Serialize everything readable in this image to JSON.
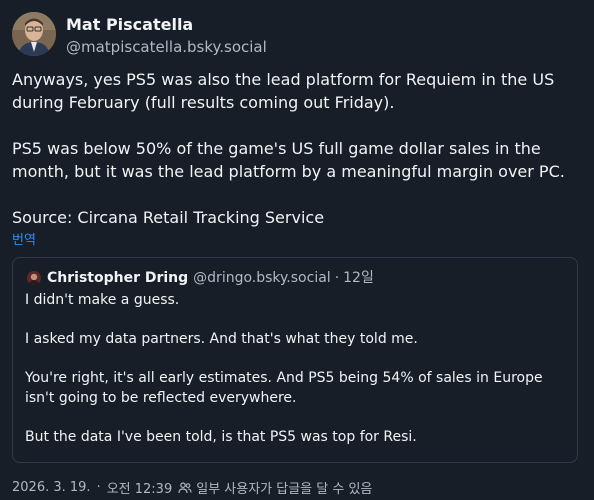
{
  "author": {
    "name": "Mat Piscatella",
    "handle": "@matpiscatella.bsky.social"
  },
  "post": {
    "paragraphs": [
      "Anyways, yes PS5 was also the lead platform for Requiem in the US during February (full results coming out Friday).",
      "PS5 was below 50% of the game's US full game dollar sales in the month, but it was the lead platform by a meaningful margin over PC.",
      "Source: Circana Retail Tracking Service"
    ],
    "translate_label": "번역"
  },
  "quote": {
    "author_name": "Christopher Dring",
    "author_handle": "@dringo.bsky.social",
    "separator": "·",
    "date": "12일",
    "paragraphs": [
      "I didn't make a guess.",
      "I asked my data partners. And that's what they told me.",
      "You're right, it's all early estimates. And PS5 being 54% of sales in Europe isn't going to be reflected everywhere.",
      "But the data I've been told, is that PS5 was top for Resi."
    ]
  },
  "footer": {
    "date": "2026. 3. 19.",
    "separator": "·",
    "time": "오전 12:39",
    "reply_restriction": "일부 사용자가 답글을 달 수 있음"
  },
  "icons": {
    "reply_restriction": "people-icon"
  },
  "colors": {
    "background": "#171e27",
    "text": "#f1f3f5",
    "muted": "#aeb9c5",
    "link": "#2f8df5",
    "border": "#2e3a49"
  }
}
